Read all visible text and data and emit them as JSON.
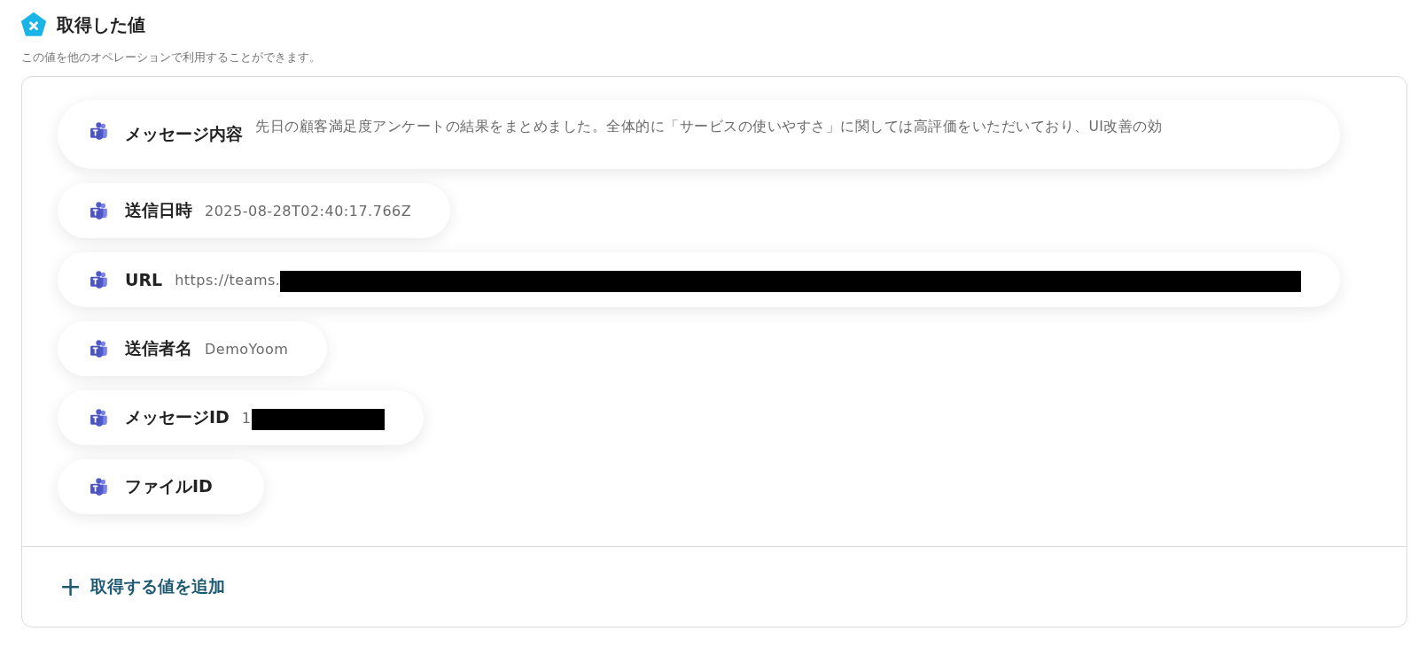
{
  "header": {
    "title": "取得した値",
    "description": "この値を他のオペレーションで利用することができます。"
  },
  "values": [
    {
      "label": "メッセージ内容",
      "value": "先日の顧客満足度アンケートの結果をまとめました。全体的に「サービスの使いやすさ」に関しては高評価をいただいており、UI改善の効",
      "redacted": false,
      "wide": true
    },
    {
      "label": "送信日時",
      "value": "2025-08-28T02:40:17.766Z",
      "redacted": false,
      "wide": false
    },
    {
      "label": "URL",
      "value": "https://teams.",
      "redacted": true,
      "wide": true
    },
    {
      "label": "送信者名",
      "value": "DemoYoom",
      "redacted": false,
      "wide": false
    },
    {
      "label": "メッセージID",
      "value": "1",
      "redacted": true,
      "wide": false
    },
    {
      "label": "ファイルID",
      "redacted": false,
      "wide": false
    }
  ],
  "add_button": {
    "icon": "+",
    "label": "取得する値を追加"
  }
}
